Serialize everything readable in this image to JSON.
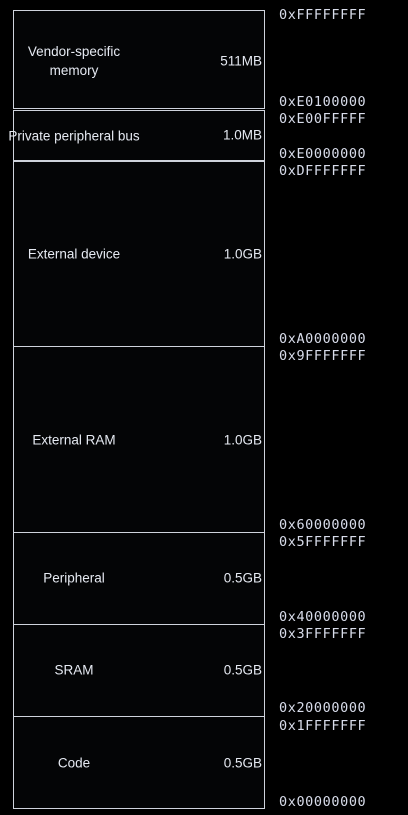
{
  "memory_map": {
    "regions": [
      {
        "name": "Vendor-specific memory",
        "size": "511MB",
        "start": "0xE0100000",
        "end": "0xFFFFFFFF"
      },
      {
        "name": "Private peripheral bus",
        "size": "1.0MB",
        "start": "0xE0000000",
        "end": "0xE00FFFFF"
      },
      {
        "name": "External device",
        "size": "1.0GB",
        "start": "0xA0000000",
        "end": "0xDFFFFFFF"
      },
      {
        "name": "External RAM",
        "size": "1.0GB",
        "start": "0x60000000",
        "end": "0x9FFFFFFF"
      },
      {
        "name": "Peripheral",
        "size": "0.5GB",
        "start": "0x40000000",
        "end": "0x5FFFFFFF"
      },
      {
        "name": "SRAM",
        "size": "0.5GB",
        "start": "0x20000000",
        "end": "0x3FFFFFFF"
      },
      {
        "name": "Code",
        "size": "0.5GB",
        "start": "0x00000000",
        "end": "0x1FFFFFFF"
      }
    ]
  }
}
